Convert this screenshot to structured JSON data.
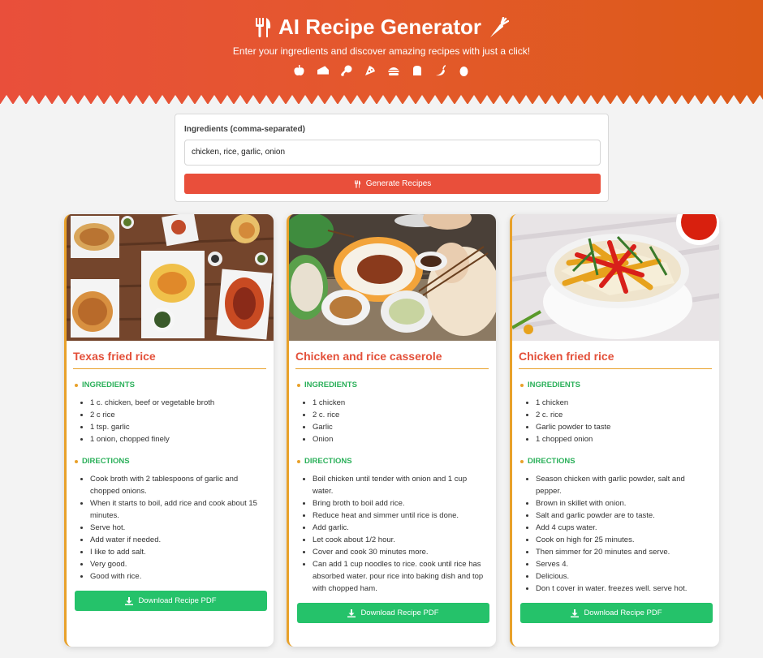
{
  "header": {
    "title": "AI Recipe Generator",
    "subtitle": "Enter your ingredients and discover amazing recipes with just a click!",
    "icons": [
      "apple-icon",
      "cheese-icon",
      "drumstick-icon",
      "pizza-icon",
      "burger-icon",
      "bread-icon",
      "pepper-icon",
      "egg-icon"
    ]
  },
  "form": {
    "label": "Ingredients (comma-separated)",
    "value": "chicken, rice, garlic, onion",
    "button_label": "Generate Recipes"
  },
  "sections": {
    "ingredients": "INGREDIENTS",
    "directions": "DIRECTIONS"
  },
  "download_label": "Download Recipe PDF",
  "colors": {
    "accent": "#e94f3b",
    "border": "#e8a12a",
    "green": "#25c26a"
  },
  "recipes": [
    {
      "title": "Texas fried rice",
      "ingredients": [
        "1 c. chicken, beef or vegetable broth",
        "2 c rice",
        "1 tsp. garlic",
        "1 onion, chopped finely"
      ],
      "directions": [
        "Cook broth with 2 tablespoons of garlic and chopped onions.",
        "When it starts to boil, add rice and cook about 15 minutes.",
        "Serve hot.",
        "Add water if needed.",
        "I like to add salt.",
        "Very good.",
        "Good with rice."
      ]
    },
    {
      "title": "Chicken and rice casserole",
      "ingredients": [
        "1 chicken",
        "2 c. rice",
        "Garlic",
        "Onion"
      ],
      "directions": [
        "Boil chicken until tender with onion and 1 cup water.",
        "Bring broth to boil add rice.",
        "Reduce heat and simmer until rice is done.",
        "Add garlic.",
        "Let cook about 1/2 hour.",
        "Cover and cook 30 minutes more.",
        "Can add 1 cup noodles to rice. cook until rice has absorbed water. pour rice into baking dish and top with chopped ham."
      ]
    },
    {
      "title": "Chicken fried rice",
      "ingredients": [
        "1 chicken",
        "2 c. rice",
        "Garlic powder to taste",
        "1 chopped onion"
      ],
      "directions": [
        "Season chicken with garlic powder, salt and pepper.",
        "Brown in skillet with onion.",
        "Salt and garlic powder are to taste.",
        "Add 4 cups water.",
        "Cook on high for 25 minutes.",
        "Then simmer for 20 minutes and serve.",
        "Serves 4.",
        "Delicious.",
        "Don t cover in water. freezes well. serve hot."
      ]
    }
  ]
}
